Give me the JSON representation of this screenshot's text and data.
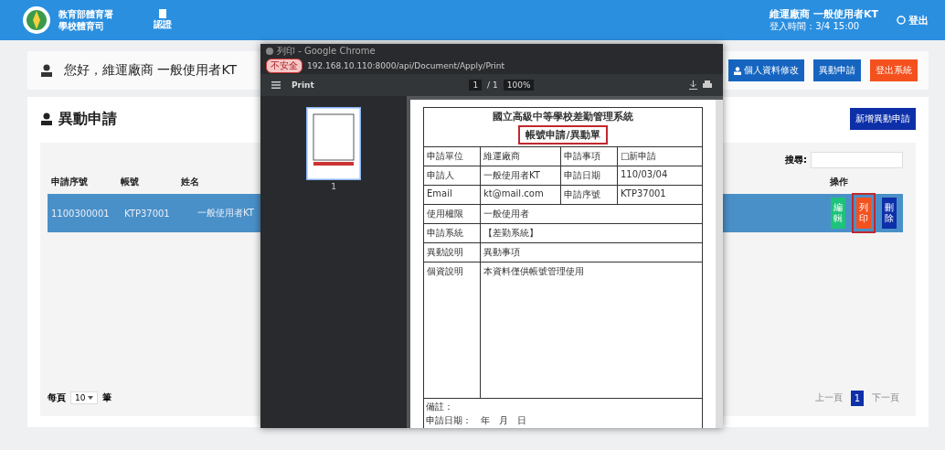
{
  "header": {
    "org_lines": [
      "教育部體育署",
      "學校體育司"
    ],
    "nav_item": "認證",
    "user": "維運廠商 一般使用者KT",
    "login_time": "登入時間：3/4 15:00",
    "logout": "登出"
  },
  "greeting": {
    "text": "您好，維運廠商 一般使用者KT",
    "buttons": [
      {
        "label": "個人資料修改",
        "kind": "primary",
        "icon": true
      },
      {
        "label": "異動申請",
        "kind": "primary",
        "icon": false
      },
      {
        "label": "登出系統",
        "kind": "danger",
        "icon": false
      }
    ]
  },
  "panel": {
    "title": "異動申請",
    "add_button": "新增異動申請",
    "search_label": "搜尋:",
    "columns": [
      "申請序號",
      "帳號",
      "姓名",
      "操作"
    ],
    "rows": [
      {
        "selected": true,
        "cells": [
          "1100300001",
          "KTP37001",
          "一般使用者KT"
        ],
        "actions": [
          {
            "label": "編輯",
            "kind": "edit",
            "highlighted": false
          },
          {
            "label": "列印",
            "kind": "print",
            "highlighted": true
          },
          {
            "label": "刪除",
            "kind": "delete",
            "highlighted": false
          }
        ]
      }
    ],
    "page_size": {
      "before": "每頁",
      "value": "10",
      "after": "筆"
    },
    "pagination": [
      {
        "label": "上一頁",
        "selected": false
      },
      {
        "label": "1",
        "selected": true
      },
      {
        "label": "下一頁",
        "selected": false
      }
    ]
  },
  "print_window": {
    "title": "列印 - Google Chrome",
    "badge": "不安全",
    "url": "192.168.10.110:8000/api/Document/Apply/Print",
    "toolbar_title": "Print",
    "page": "1",
    "pages": "/ 1",
    "zoom": "100%",
    "thumb_number": "1",
    "document": {
      "title": "國立高級中等學校差勤管理系統",
      "subtitle": "帳號申請/異動單",
      "subtitle_highlighted": true,
      "grid_rows": [
        [
          "申請單位",
          "維運廠商",
          "申請事項",
          "□新申請"
        ],
        [
          "申請人",
          "一般使用者KT",
          "申請日期",
          "110/03/04"
        ],
        [
          "Email",
          "kt@mail.com",
          "申請序號",
          "KTP37001"
        ]
      ],
      "wide_rows": [
        [
          "使用權限",
          "一般使用者"
        ],
        [
          "申請系統",
          "【差勤系統】"
        ],
        [
          "異動說明",
          "異動事項"
        ],
        [
          "個資說明",
          "本資料僅供帳號管理使用"
        ]
      ],
      "footer": [
        "備註：",
        "申請日期：　年　月　日"
      ]
    }
  }
}
